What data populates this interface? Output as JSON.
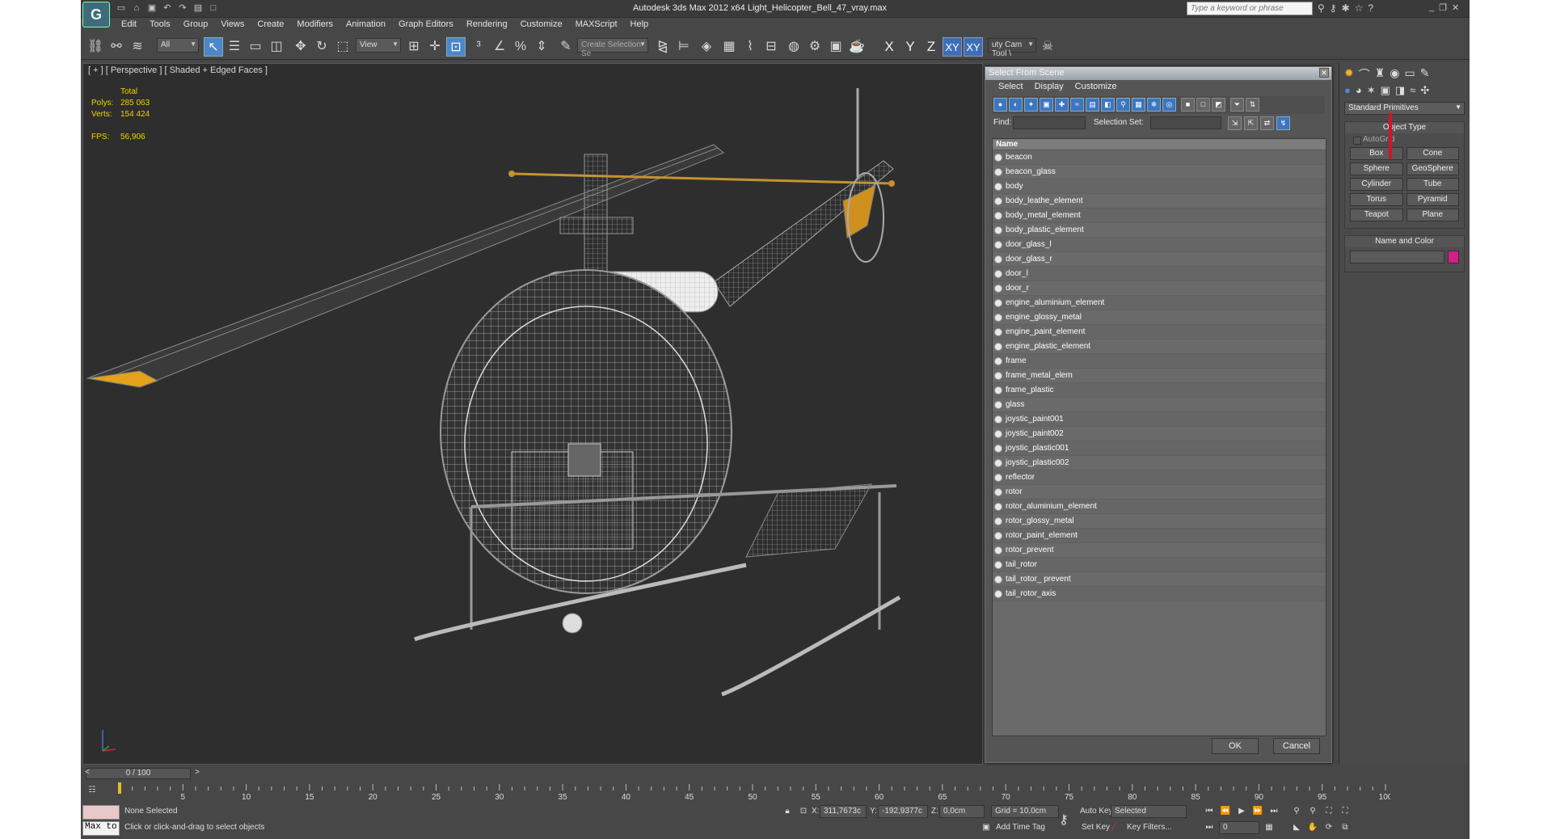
{
  "window": {
    "title": "Autodesk 3ds Max  2012 x64    Light_Helicopter_Bell_47_vray.max",
    "search_placeholder": "Type a keyword or phrase",
    "logo": "G"
  },
  "menu": [
    "Edit",
    "Tools",
    "Group",
    "Views",
    "Create",
    "Modifiers",
    "Animation",
    "Graph Editors",
    "Rendering",
    "Customize",
    "MAXScript",
    "Help"
  ],
  "toolbar": {
    "filter_value": "All",
    "refcoord_value": "View",
    "named_selection_placeholder": "Create Selection Se",
    "axes": [
      "X",
      "Y",
      "Z",
      "XY",
      "XY"
    ],
    "cam_tool_label": "uty Cam Tool \\"
  },
  "viewport": {
    "label": "[ + ] [ Perspective ] [ Shaded + Edged Faces ]",
    "stats": {
      "total_label": "Total",
      "polys_label": "Polys:",
      "polys_value": "285 063",
      "verts_label": "Verts:",
      "verts_value": "154 424",
      "fps_label": "FPS:",
      "fps_value": "56,906"
    }
  },
  "dialog": {
    "title": "Select From Scene",
    "menu": [
      "Select",
      "Display",
      "Customize"
    ],
    "find_label": "Find:",
    "selection_set_label": "Selection Set:",
    "column_name": "Name",
    "objects": [
      "beacon",
      "beacon_glass",
      "body",
      "body_leathe_element",
      "body_metal_element",
      "body_plastic_element",
      "door_glass_l",
      "door_glass_r",
      "door_l",
      "door_r",
      "engine_aluminium_element",
      "engine_glossy_metal",
      "engine_paint_element",
      "engine_plastic_element",
      "frame",
      "frame_metal_elem",
      "frame_plastic",
      "glass",
      "joystic_paint001",
      "joystic_paint002",
      "joystic_plastic001",
      "joystic_plastic002",
      "reflector",
      "rotor",
      "rotor_aluminium_element",
      "rotor_glossy_metal",
      "rotor_paint_element",
      "rotor_prevent",
      "tail_rotor",
      "tail_rotor_ prevent",
      "tail_rotor_axis"
    ],
    "ok_label": "OK",
    "cancel_label": "Cancel"
  },
  "command_panel": {
    "category": "Standard Primitives",
    "object_type_label": "Object Type",
    "autogrid_label": "AutoGrid",
    "primitives": [
      "Box",
      "Cone",
      "Sphere",
      "GeoSphere",
      "Cylinder",
      "Tube",
      "Torus",
      "Pyramid",
      "Teapot",
      "Plane"
    ],
    "name_color_label": "Name and Color",
    "object_color": "#d81b8a"
  },
  "timeline": {
    "frame_readout": "0 / 100",
    "ticks": [
      "0",
      "5",
      "10",
      "15",
      "20",
      "25",
      "30",
      "35",
      "40",
      "45",
      "50",
      "55",
      "60",
      "65",
      "70",
      "75",
      "80",
      "85",
      "90",
      "95",
      "100"
    ]
  },
  "status": {
    "maxscript_label": "Max to",
    "selection_status": "None Selected",
    "prompt": "Click or click-and-drag to select objects",
    "x_label": "X:",
    "x_value": "311,7673c",
    "y_label": "Y:",
    "y_value": "-192,9377c",
    "z_label": "Z:",
    "z_value": "0,0cm",
    "grid": "Grid = 10,0cm",
    "add_time_tag": "Add Time Tag",
    "auto_key": "Auto Key",
    "set_key": "Set Key",
    "key_mode_value": "Selected",
    "key_filters": "Key Filters...",
    "current_frame": "0"
  }
}
